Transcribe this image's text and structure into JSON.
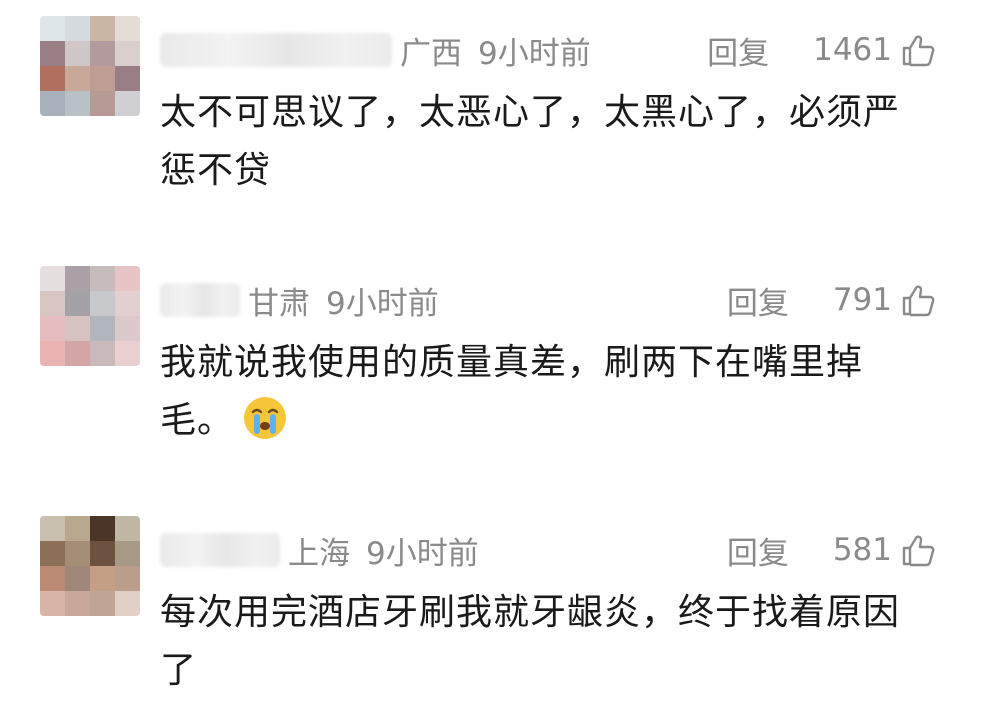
{
  "comments": [
    {
      "region": "广西",
      "time": "9小时前",
      "reply_label": "回复",
      "likes": "1461",
      "text": "太不可思议了，太恶心了，太黑心了，必须严惩不贷",
      "avatar_colors": [
        "#dfe6ea",
        "#d4dadd",
        "#c9b6a3",
        "#e4ddd6",
        "#9b7f86",
        "#cfc6c8",
        "#b39a9c",
        "#d9cfcd",
        "#b27061",
        "#c7a899",
        "#bf9d93",
        "#9a7e86",
        "#a8b0bb",
        "#b7c1c6",
        "#b79995",
        "#cfcfd4"
      ]
    },
    {
      "region": "甘肃",
      "time": "9小时前",
      "reply_label": "回复",
      "likes": "791",
      "text": "我就说我使用的质量真差，刷两下在嘴里掉毛。",
      "emoji": "crying-face",
      "avatar_colors": [
        "#e6dfe0",
        "#a9a0a8",
        "#c7bcbc",
        "#e8c4c4",
        "#d8c6c3",
        "#a4a2a6",
        "#c6c8cc",
        "#e3cfd0",
        "#e6bcbf",
        "#d6c3c1",
        "#b1b6bd",
        "#dcc9cb",
        "#e8b3b1",
        "#d3a5a5",
        "#c9b9bb",
        "#e9cfcf"
      ]
    },
    {
      "region": "上海",
      "time": "9小时前",
      "reply_label": "回复",
      "likes": "581",
      "text": "每次用完酒店牙刷我就牙龈炎，终于找着原因了",
      "avatar_colors": [
        "#c8bfae",
        "#b8a890",
        "#4a3528",
        "#bfb7a4",
        "#8b7057",
        "#a58e78",
        "#6e5240",
        "#a69a86",
        "#bb8a74",
        "#a0877a",
        "#c49e85",
        "#ba9d8a",
        "#d7b4a6",
        "#caa899",
        "#c0a592",
        "#e0d0c6"
      ]
    }
  ],
  "icons": {
    "like": "thumbs-up-icon",
    "emoji": "crying-face-icon"
  },
  "colors": {
    "meta_text": "#8a8a8a",
    "body_text": "#1a1a1a"
  }
}
